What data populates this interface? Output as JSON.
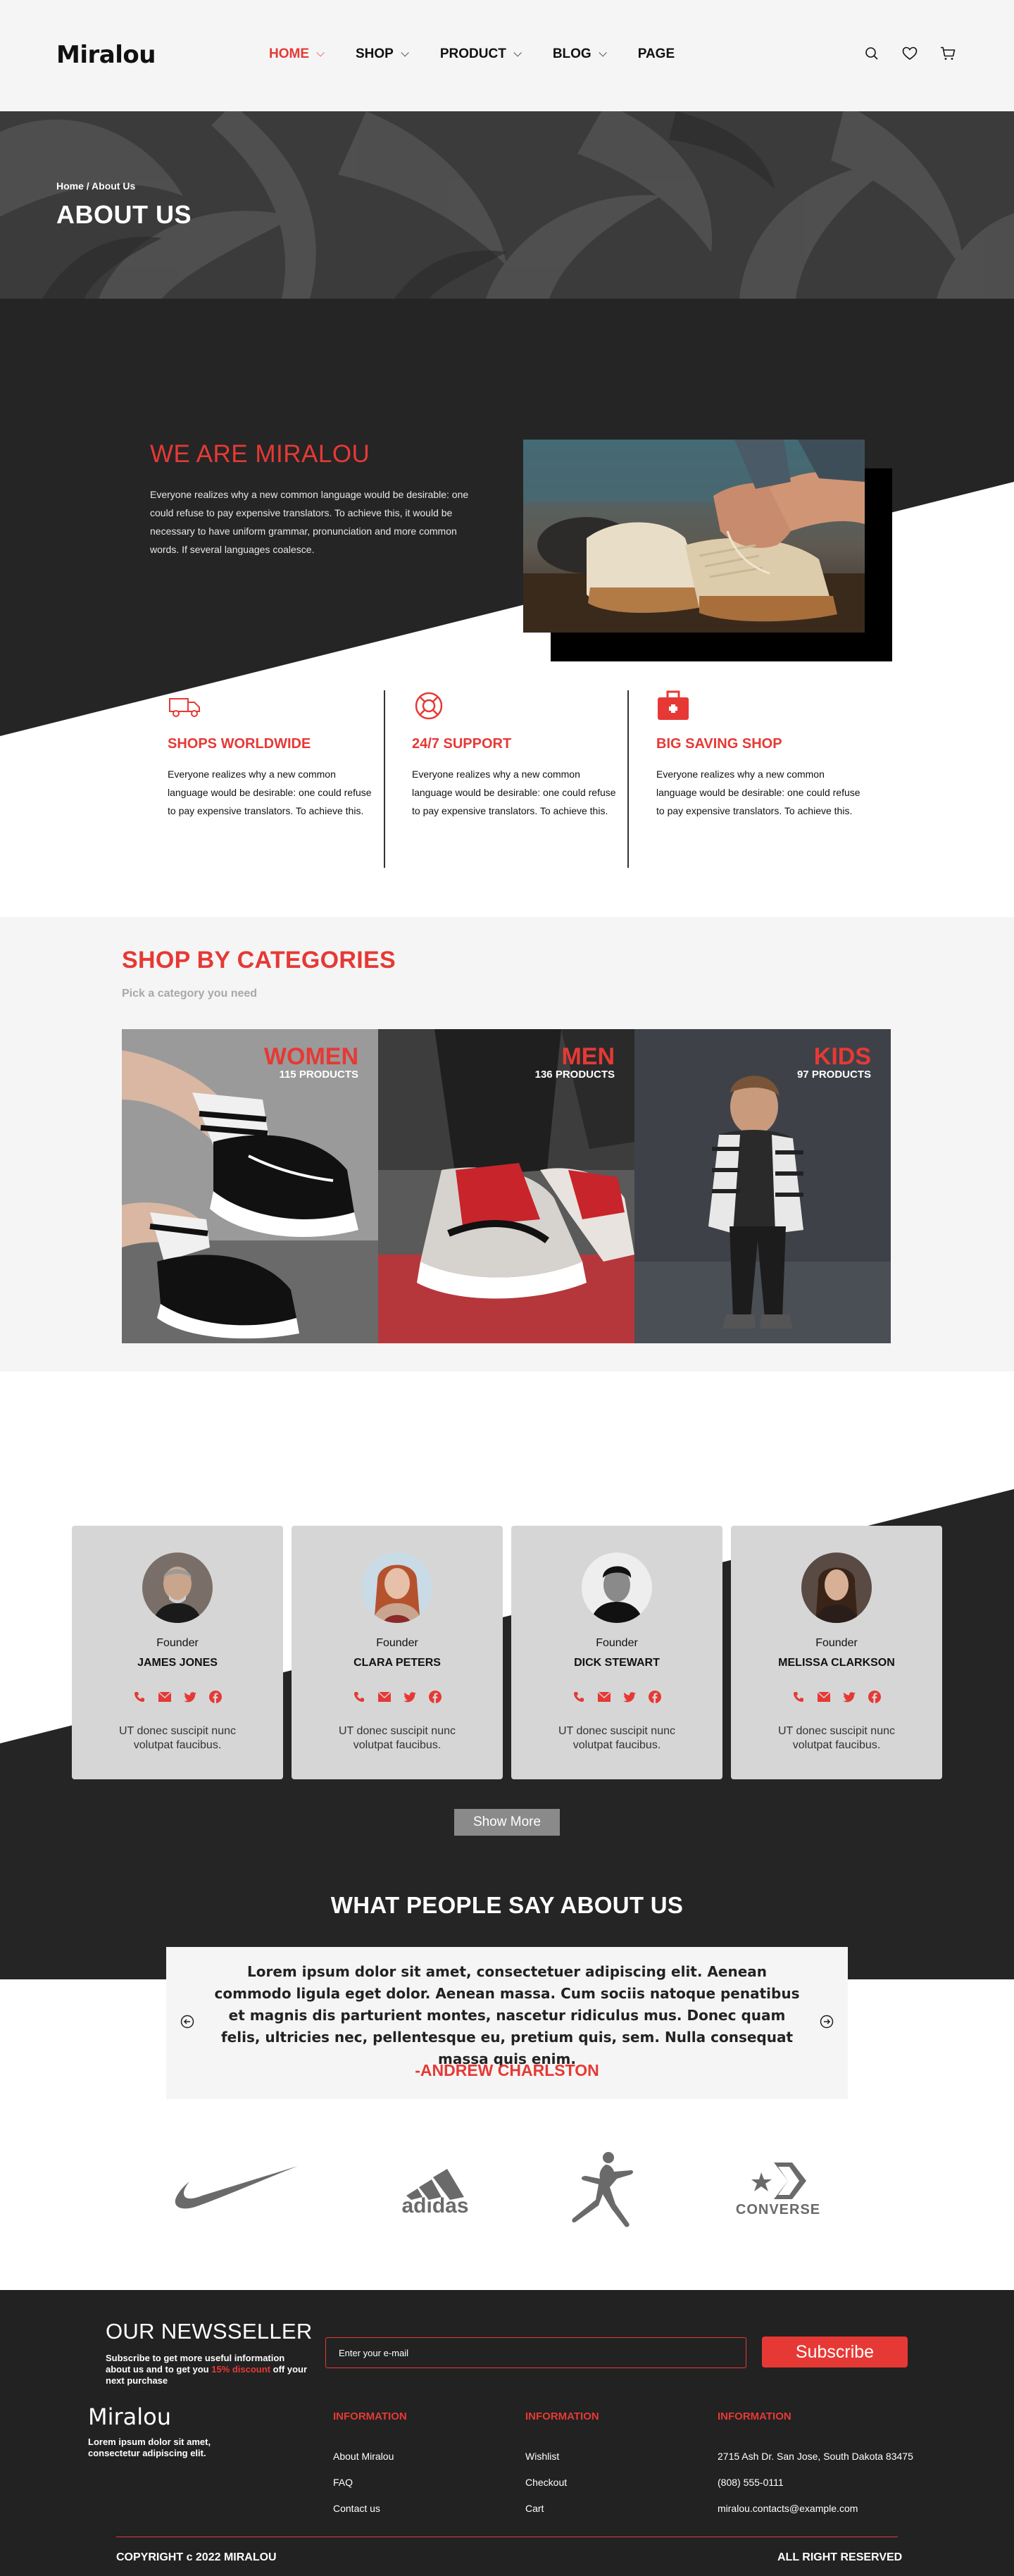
{
  "header": {
    "logo": "Miralou",
    "nav": [
      {
        "label": "HOME",
        "active": true,
        "dropdown": true
      },
      {
        "label": "SHOP",
        "active": false,
        "dropdown": true
      },
      {
        "label": "PRODUCT",
        "active": false,
        "dropdown": true
      },
      {
        "label": "BLOG",
        "active": false,
        "dropdown": true
      },
      {
        "label": "PAGE",
        "active": false,
        "dropdown": false
      }
    ],
    "icons": [
      "search-icon",
      "heart-icon",
      "cart-icon"
    ]
  },
  "banner": {
    "breadcrumb": "Home / About Us",
    "title": "ABOUT US"
  },
  "about": {
    "title": "WE ARE MIRALOU",
    "text": "Everyone realizes why a new common language would be desirable: one could refuse to pay expensive translators. To achieve this, it would be necessary to have uniform grammar, pronunciation and more common words. If several languages coalesce."
  },
  "features": [
    {
      "icon": "truck-icon",
      "title": "SHOPS WORLDWIDE",
      "text": "Everyone realizes why a new common language would be desirable: one could refuse to pay expensive translators. To achieve this."
    },
    {
      "icon": "lifebuoy-icon",
      "title": "24/7 SUPPORT",
      "text": "Everyone realizes why a new common language would be desirable: one could refuse to pay expensive translators. To achieve this."
    },
    {
      "icon": "briefcase-icon",
      "title": "BIG SAVING SHOP",
      "text": "Everyone realizes why a new common language would be desirable: one could refuse to pay expensive translators. To achieve this."
    }
  ],
  "categories": {
    "title": "SHOP BY CATEGORIES",
    "subtitle": "Pick a category you need",
    "items": [
      {
        "name": "WOMEN",
        "count": "115 PRODUCTS"
      },
      {
        "name": "MEN",
        "count": "136 PRODUCTS"
      },
      {
        "name": "KIDS",
        "count": "97 PRODUCTS"
      }
    ]
  },
  "team": {
    "members": [
      {
        "role": "Founder",
        "name": "JAMES JONES",
        "quote": "UT donec suscipit nunc volutpat faucibus."
      },
      {
        "role": "Founder",
        "name": "CLARA PETERS",
        "quote": "UT donec suscipit nunc volutpat faucibus."
      },
      {
        "role": "Founder",
        "name": "DICK STEWART",
        "quote": "UT donec suscipit nunc volutpat faucibus."
      },
      {
        "role": "Founder",
        "name": "MELISSA CLARKSON",
        "quote": "UT donec suscipit nunc volutpat faucibus."
      }
    ],
    "social_icons": [
      "phone-icon",
      "mail-icon",
      "twitter-icon",
      "facebook-icon"
    ],
    "show_more": "Show More"
  },
  "testimonials": {
    "title": "WHAT PEOPLE SAY ABOUT US",
    "text": "Lorem ipsum dolor sit amet, consectetuer adipiscing elit. Aenean commodo ligula eget dolor. Aenean massa. Cum sociis natoque penatibus et magnis dis parturient montes, nascetur ridiculus mus. Donec quam felis, ultricies nec, pellentesque eu, pretium quis, sem. Nulla consequat massa quis enim.",
    "author": "-ANDREW CHARLSTON"
  },
  "brands": [
    {
      "name": "nike-logo"
    },
    {
      "name": "adidas-logo",
      "text": "adidas"
    },
    {
      "name": "jordan-logo"
    },
    {
      "name": "converse-logo",
      "text": "CONVERSE"
    }
  ],
  "footer": {
    "news_title": "OUR NEWSSELLER",
    "news_text_1": "Subscribe to get more useful information about us and to get you ",
    "news_text_red": "15% discount",
    "news_text_2": " off your next purchase",
    "email_placeholder": "Enter your e-mail",
    "subscribe": "Subscribe",
    "logo": "Miralou",
    "desc": "Lorem ipsum dolor sit amet, consectetur adipiscing elit.",
    "columns": [
      {
        "title": "INFORMATION",
        "links": [
          "About Miralou",
          "FAQ",
          "Contact us"
        ]
      },
      {
        "title": "INFORMATION",
        "links": [
          "Wishlist",
          "Checkout",
          "Cart"
        ]
      },
      {
        "title": "INFORMATION",
        "links": [
          "2715 Ash Dr. San Jose, South Dakota 83475",
          "(808) 555-0111",
          "miralou.contacts@example.com"
        ]
      }
    ],
    "copyright": "COPYRIGHT c 2022 MIRALOU",
    "rights": "ALL RIGHT RESERVED"
  },
  "colors": {
    "accent": "#e63935",
    "dark": "#252525",
    "light": "#f5f5f5"
  }
}
